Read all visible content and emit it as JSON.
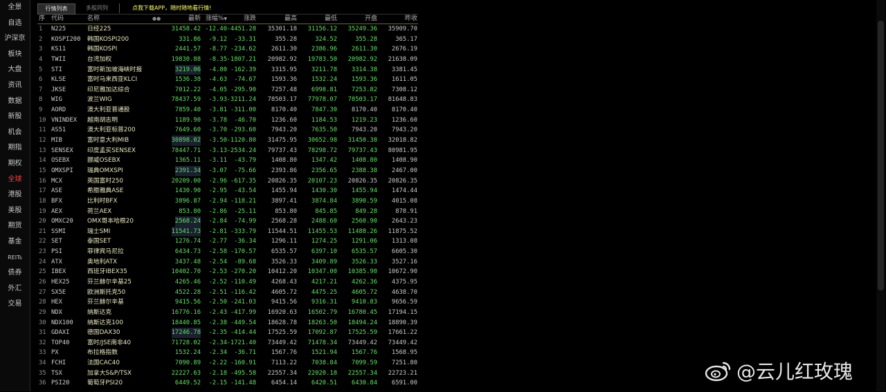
{
  "sidebar": {
    "items": [
      {
        "label": "全景"
      },
      {
        "label": "自选"
      },
      {
        "label": "沪深京"
      },
      {
        "label": "板块"
      },
      {
        "label": "大盘"
      },
      {
        "label": "资讯"
      },
      {
        "label": "数据"
      },
      {
        "label": "新股"
      },
      {
        "label": "机会"
      },
      {
        "label": "期指"
      },
      {
        "label": "期权"
      },
      {
        "label": "全球"
      },
      {
        "label": "港股"
      },
      {
        "label": "美股"
      },
      {
        "label": "期货"
      },
      {
        "label": "基金"
      },
      {
        "label": "REITs"
      },
      {
        "label": "债券"
      },
      {
        "label": "外汇"
      },
      {
        "label": "交易"
      }
    ],
    "active_index": 11
  },
  "tabs": {
    "list": "行情列表",
    "multi": "多股同列"
  },
  "promo": "点我下载APP，随时随地看行情!",
  "columns": {
    "seq": "序",
    "code": "代码",
    "name": "名称",
    "latest": "最新",
    "pct": "涨幅%",
    "chg": "涨跌",
    "high": "最高",
    "low": "最低",
    "open": "开盘",
    "prev": "昨收"
  },
  "header_dots": "●●",
  "rows": [
    {
      "seq": "1",
      "code": "N225",
      "name": "日经225",
      "latest": "31458.42",
      "pct": "-12.40",
      "chg": "-4451.28",
      "high": "35301.18",
      "low": "31156.12",
      "open": "35249.36",
      "prev": "35909.70"
    },
    {
      "seq": "2",
      "code": "KOSPI200",
      "name": "韩国KOSPI200",
      "latest": "331.86",
      "pct": "-9.12",
      "chg": "-33.31",
      "high": "355.28",
      "low": "324.52",
      "open": "355.28",
      "prev": "365.17"
    },
    {
      "seq": "3",
      "code": "KS11",
      "name": "韩国KOSPI",
      "latest": "2441.57",
      "pct": "-8.77",
      "chg": "-234.62",
      "high": "2611.30",
      "low": "2386.96",
      "open": "2611.30",
      "prev": "2676.19"
    },
    {
      "seq": "4",
      "code": "TWII",
      "name": "台湾加权",
      "latest": "19830.88",
      "pct": "-8.35",
      "chg": "-1807.21",
      "high": "20982.92",
      "low": "19783.50",
      "open": "20982.92",
      "prev": "21638.09"
    },
    {
      "seq": "5",
      "code": "STI",
      "name": "富时新加坡海峡时报",
      "latest": "3219.06",
      "pct": "-4.80",
      "chg": "-162.39",
      "high": "3315.95",
      "low": "3211.78",
      "open": "3314.38",
      "prev": "3381.45"
    },
    {
      "seq": "6",
      "code": "KLSE",
      "name": "富时马来西亚KLCI",
      "latest": "1536.38",
      "pct": "-4.63",
      "chg": "-74.67",
      "high": "1593.36",
      "low": "1532.24",
      "open": "1593.36",
      "prev": "1611.05"
    },
    {
      "seq": "7",
      "code": "JKSE",
      "name": "印尼雅加达综合",
      "latest": "7012.22",
      "pct": "-4.05",
      "chg": "-295.90",
      "high": "7257.48",
      "low": "6998.81",
      "open": "7253.82",
      "prev": "7308.12"
    },
    {
      "seq": "8",
      "code": "WIG",
      "name": "波兰WIG",
      "latest": "78437.59",
      "pct": "-3.93",
      "chg": "-3211.24",
      "high": "78503.17",
      "low": "77978.07",
      "open": "78503.17",
      "prev": "81648.83"
    },
    {
      "seq": "9",
      "code": "AORD",
      "name": "澳大利亚普通股",
      "latest": "7859.40",
      "pct": "-3.81",
      "chg": "-311.00",
      "high": "8170.40",
      "low": "7847.30",
      "open": "8170.40",
      "prev": "8170.40"
    },
    {
      "seq": "10",
      "code": "VNINDEX",
      "name": "越南胡志明",
      "latest": "1189.90",
      "pct": "-3.78",
      "chg": "-46.70",
      "high": "1236.60",
      "low": "1184.53",
      "open": "1219.23",
      "prev": "1236.60"
    },
    {
      "seq": "11",
      "code": "AS51",
      "name": "澳大利亚标普200",
      "latest": "7649.60",
      "pct": "-3.70",
      "chg": "-293.60",
      "high": "7943.20",
      "low": "7635.50",
      "open": "7943.20",
      "prev": "7943.20"
    },
    {
      "seq": "12",
      "code": "MIB",
      "name": "富时意大利MIB",
      "latest": "30898.02",
      "pct": "-3.50",
      "chg": "-1120.80",
      "high": "31475.95",
      "low": "30652.98",
      "open": "31450.38",
      "prev": "32018.82"
    },
    {
      "seq": "13",
      "code": "SENSEX",
      "name": "印度孟买SENSEX",
      "latest": "78447.71",
      "pct": "-3.13",
      "chg": "-2534.24",
      "high": "79737.43",
      "low": "78298.72",
      "open": "79737.43",
      "prev": "80981.95"
    },
    {
      "seq": "14",
      "code": "OSEBX",
      "name": "挪威OSEBX",
      "latest": "1365.11",
      "pct": "-3.11",
      "chg": "-43.79",
      "high": "1408.80",
      "low": "1347.42",
      "open": "1408.80",
      "prev": "1408.90"
    },
    {
      "seq": "15",
      "code": "OMXSPI",
      "name": "瑞典OMXSPI",
      "latest": "2391.34",
      "pct": "-3.07",
      "chg": "-75.66",
      "high": "2393.86",
      "low": "2356.65",
      "open": "2388.38",
      "prev": "2467.00"
    },
    {
      "seq": "16",
      "code": "MCX",
      "name": "英国富时250",
      "latest": "20209.00",
      "pct": "-2.96",
      "chg": "-617.35",
      "high": "20826.35",
      "low": "20107.23",
      "open": "20826.35",
      "prev": "20826.35"
    },
    {
      "seq": "17",
      "code": "ASE",
      "name": "希腊雅典ASE",
      "latest": "1430.90",
      "pct": "-2.95",
      "chg": "-43.54",
      "high": "1455.94",
      "low": "1430.30",
      "open": "1455.94",
      "prev": "1474.44"
    },
    {
      "seq": "18",
      "code": "BFX",
      "name": "比利时BFX",
      "latest": "3896.87",
      "pct": "-2.94",
      "chg": "-118.21",
      "high": "3897.41",
      "low": "3874.84",
      "open": "3890.59",
      "prev": "4015.08"
    },
    {
      "seq": "19",
      "code": "AEX",
      "name": "荷兰AEX",
      "latest": "853.80",
      "pct": "-2.86",
      "chg": "-25.11",
      "high": "853.80",
      "low": "845.85",
      "open": "849.28",
      "prev": "878.91"
    },
    {
      "seq": "20",
      "code": "OMXC20",
      "name": "OMX哥本哈根20",
      "latest": "2568.24",
      "pct": "-2.84",
      "chg": "-74.99",
      "high": "2568.28",
      "low": "2488.60",
      "open": "2560.90",
      "prev": "2643.23"
    },
    {
      "seq": "21",
      "code": "SSMI",
      "name": "瑞士SMI",
      "latest": "11541.73",
      "pct": "-2.81",
      "chg": "-333.79",
      "high": "11544.51",
      "low": "11455.53",
      "open": "11488.26",
      "prev": "11875.52"
    },
    {
      "seq": "22",
      "code": "SET",
      "name": "泰国SET",
      "latest": "1276.74",
      "pct": "-2.77",
      "chg": "-36.34",
      "high": "1296.11",
      "low": "1274.25",
      "open": "1291.06",
      "prev": "1313.08"
    },
    {
      "seq": "23",
      "code": "PSI",
      "name": "菲律宾马尼拉",
      "latest": "6434.73",
      "pct": "-2.58",
      "chg": "-170.57",
      "high": "6535.57",
      "low": "6397.10",
      "open": "6535.57",
      "prev": "6605.30"
    },
    {
      "seq": "24",
      "code": "ATX",
      "name": "奥地利ATX",
      "latest": "3437.48",
      "pct": "-2.54",
      "chg": "-89.68",
      "high": "3526.33",
      "low": "3409.89",
      "open": "3526.33",
      "prev": "3527.16"
    },
    {
      "seq": "25",
      "code": "IBEX",
      "name": "西班牙IBEX35",
      "latest": "10402.70",
      "pct": "-2.53",
      "chg": "-270.20",
      "high": "10412.20",
      "low": "10347.00",
      "open": "10385.90",
      "prev": "10672.90"
    },
    {
      "seq": "26",
      "code": "HEX25",
      "name": "芬兰赫尔辛基25",
      "latest": "4265.46",
      "pct": "-2.52",
      "chg": "-110.49",
      "high": "4268.43",
      "low": "4217.21",
      "open": "4262.36",
      "prev": "4375.95"
    },
    {
      "seq": "27",
      "code": "SX5E",
      "name": "欧洲斯托克50",
      "latest": "4522.28",
      "pct": "-2.51",
      "chg": "-116.42",
      "high": "4605.72",
      "low": "4475.25",
      "open": "4605.72",
      "prev": "4638.70"
    },
    {
      "seq": "28",
      "code": "HEX",
      "name": "芬兰赫尔辛基",
      "latest": "9415.56",
      "pct": "-2.50",
      "chg": "-241.03",
      "high": "9415.56",
      "low": "9316.31",
      "open": "9410.83",
      "prev": "9656.59"
    },
    {
      "seq": "29",
      "code": "NDX",
      "name": "纳斯达克",
      "latest": "16776.16",
      "pct": "-2.43",
      "chg": "-417.99",
      "high": "16920.63",
      "low": "16502.79",
      "open": "16780.45",
      "prev": "17194.15"
    },
    {
      "seq": "30",
      "code": "NDX100",
      "name": "纳斯达克100",
      "latest": "18440.85",
      "pct": "-2.38",
      "chg": "-449.54",
      "high": "18628.78",
      "low": "18263.50",
      "open": "18494.24",
      "prev": "18890.39"
    },
    {
      "seq": "31",
      "code": "GDAXI",
      "name": "德国DAX30",
      "latest": "17246.78",
      "pct": "-2.35",
      "chg": "-414.44",
      "high": "17525.59",
      "low": "17092.87",
      "open": "17525.59",
      "prev": "17661.22"
    },
    {
      "seq": "32",
      "code": "TOP40",
      "name": "富时/JSE南非40",
      "latest": "71728.02",
      "pct": "-2.34",
      "chg": "-1721.40",
      "high": "73449.42",
      "low": "71478.34",
      "open": "73449.42",
      "prev": "73449.42"
    },
    {
      "seq": "33",
      "code": "PX",
      "name": "布拉格指数",
      "latest": "1532.24",
      "pct": "-2.34",
      "chg": "-36.71",
      "high": "1567.76",
      "low": "1521.94",
      "open": "1567.76",
      "prev": "1568.95"
    },
    {
      "seq": "34",
      "code": "FCHI",
      "name": "法国CAC40",
      "latest": "7090.89",
      "pct": "-2.22",
      "chg": "-160.91",
      "high": "7113.22",
      "low": "7038.84",
      "open": "7099.59",
      "prev": "7251.80"
    },
    {
      "seq": "35",
      "code": "TSX",
      "name": "加拿大S&P/TSX",
      "latest": "22227.63",
      "pct": "-2.18",
      "chg": "-495.58",
      "high": "22557.34",
      "low": "22020.18",
      "open": "22557.34",
      "prev": "22723.21"
    },
    {
      "seq": "36",
      "code": "PSI20",
      "name": "葡萄牙PSI20",
      "latest": "6449.52",
      "pct": "-2.15",
      "chg": "-141.48",
      "high": "6454.14",
      "low": "6420.51",
      "open": "6430.84",
      "prev": "6591.00"
    }
  ],
  "highlight_rows": [
    4,
    11,
    14,
    19,
    20,
    30
  ],
  "watermark": {
    "text": "@云儿红玫瑰",
    "icon": "weibo-icon"
  },
  "colors": {
    "up_down_green": "#5ee65e",
    "active_red": "#ff4040",
    "promo_yellow": "#ffff66"
  }
}
